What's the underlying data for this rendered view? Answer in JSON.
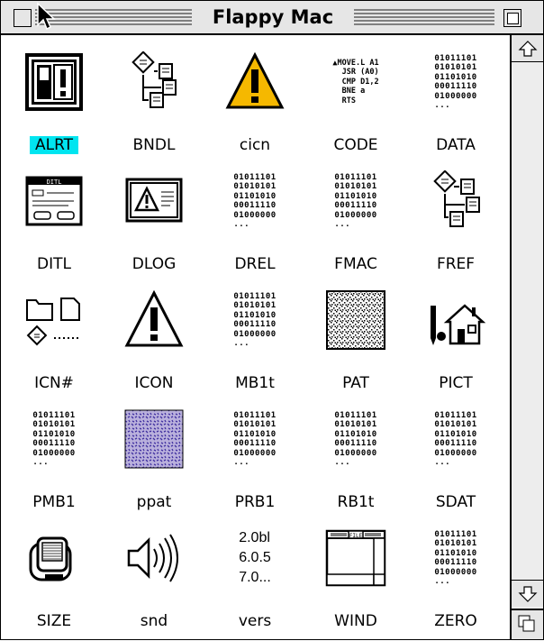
{
  "window": {
    "title": "Flappy Mac"
  },
  "items": [
    {
      "label": "ALRT",
      "icon": "alert-dialog-icon",
      "selected": true
    },
    {
      "label": "BNDL",
      "icon": "bundle-icon"
    },
    {
      "label": "cicn",
      "icon": "color-warning-icon"
    },
    {
      "label": "CODE",
      "icon": "code-icon"
    },
    {
      "label": "DATA",
      "icon": "binary-data-icon"
    },
    {
      "label": "DITL",
      "icon": "dialog-items-icon"
    },
    {
      "label": "DLOG",
      "icon": "dialog-window-icon"
    },
    {
      "label": "DREL",
      "icon": "binary-data-icon"
    },
    {
      "label": "FMAC",
      "icon": "binary-data-icon"
    },
    {
      "label": "FREF",
      "icon": "file-reference-icon"
    },
    {
      "label": "ICN#",
      "icon": "icon-list-icon"
    },
    {
      "label": "ICON",
      "icon": "warning-icon"
    },
    {
      "label": "MB1t",
      "icon": "binary-data-icon"
    },
    {
      "label": "PAT",
      "icon": "pattern-icon"
    },
    {
      "label": "PICT",
      "icon": "picture-icon"
    },
    {
      "label": "PMB1",
      "icon": "binary-data-icon"
    },
    {
      "label": "ppat",
      "icon": "color-pattern-icon"
    },
    {
      "label": "PRB1",
      "icon": "binary-data-icon"
    },
    {
      "label": "RB1t",
      "icon": "binary-data-icon"
    },
    {
      "label": "SDAT",
      "icon": "binary-data-icon"
    },
    {
      "label": "SIZE",
      "icon": "mac-size-icon"
    },
    {
      "label": "snd",
      "icon": "speaker-icon"
    },
    {
      "label": "vers",
      "icon": "version-icon"
    },
    {
      "label": "WIND",
      "icon": "window-icon"
    },
    {
      "label": "ZERO",
      "icon": "binary-data-icon"
    }
  ],
  "icon_text": {
    "bits": "01011101\n01010101\n01101010\n00011110\n01000000\n...",
    "code": "▲MOVE.L A1\n  JSR (A0)\n  CMP D1,2\n  BNE a\n  RTS",
    "vers": "2.0bl\n6.0.5\n7.0..."
  },
  "colors": {
    "selection": "#00e5f0",
    "warning_fill": "#f5b800",
    "pattern_fill": "#b9b0dc",
    "pattern_dots": "#4030a0",
    "chrome": "#e6e6e6"
  }
}
